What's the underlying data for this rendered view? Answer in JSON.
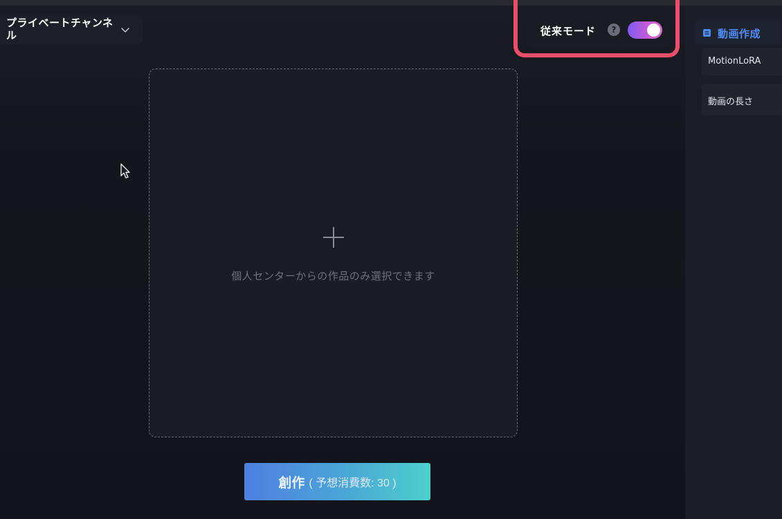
{
  "header": {
    "channel_label": "プライベートチャンネル"
  },
  "mode": {
    "label": "従来モード",
    "help_glyph": "?",
    "toggle_on": true
  },
  "upload": {
    "hint": "個人センターからの作品のみ選択できます"
  },
  "create_button": {
    "label": "創作",
    "estimate": "( 予想消費数: 30 )"
  },
  "right_panel": {
    "title": "動画作成",
    "items": [
      {
        "label": "MotionLoRA"
      },
      {
        "label": "動画の長さ"
      }
    ]
  },
  "colors": {
    "background": "#15161d",
    "accent_blue": "#4f8df5",
    "highlight_red": "#e84f6a",
    "toggle_gradient_start": "#7a5cf0",
    "toggle_gradient_end": "#e06acb",
    "button_gradient_start": "#4f7fe0",
    "button_gradient_end": "#4ed0cc"
  },
  "icons": [
    "chevron-down-icon",
    "help-icon",
    "plus-icon",
    "document-icon",
    "mouse-cursor-icon"
  ]
}
